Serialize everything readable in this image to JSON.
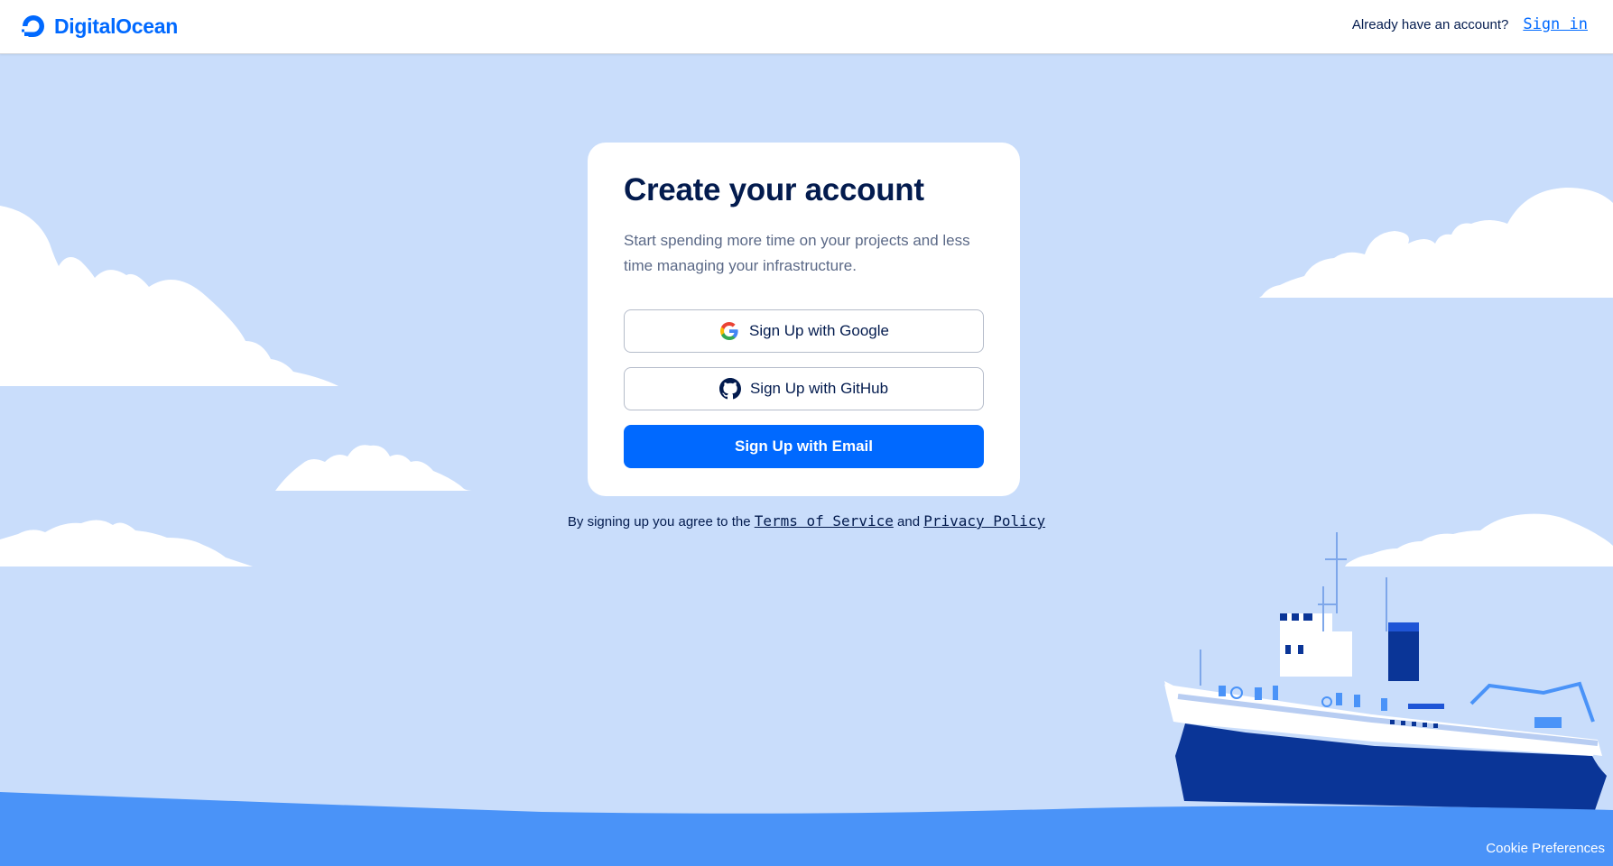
{
  "header": {
    "brand": "DigitalOcean",
    "already_text": "Already have an account?",
    "signin_label": "Sign in"
  },
  "card": {
    "title": "Create your account",
    "subtitle": "Start spending more time on your projects and less time managing your infrastructure.",
    "google_label": "Sign Up with Google",
    "github_label": "Sign Up with GitHub",
    "email_label": "Sign Up with Email"
  },
  "terms": {
    "prefix": "By signing up you agree to the",
    "tos_label": "Terms of Service",
    "and": "and",
    "privacy_label": "Privacy Policy"
  },
  "footer": {
    "cookie_label": "Cookie Preferences"
  },
  "colors": {
    "brand_blue": "#0069ff",
    "sky": "#c9ddfb",
    "sea": "#4a93f8",
    "hull": "#0a3597"
  }
}
